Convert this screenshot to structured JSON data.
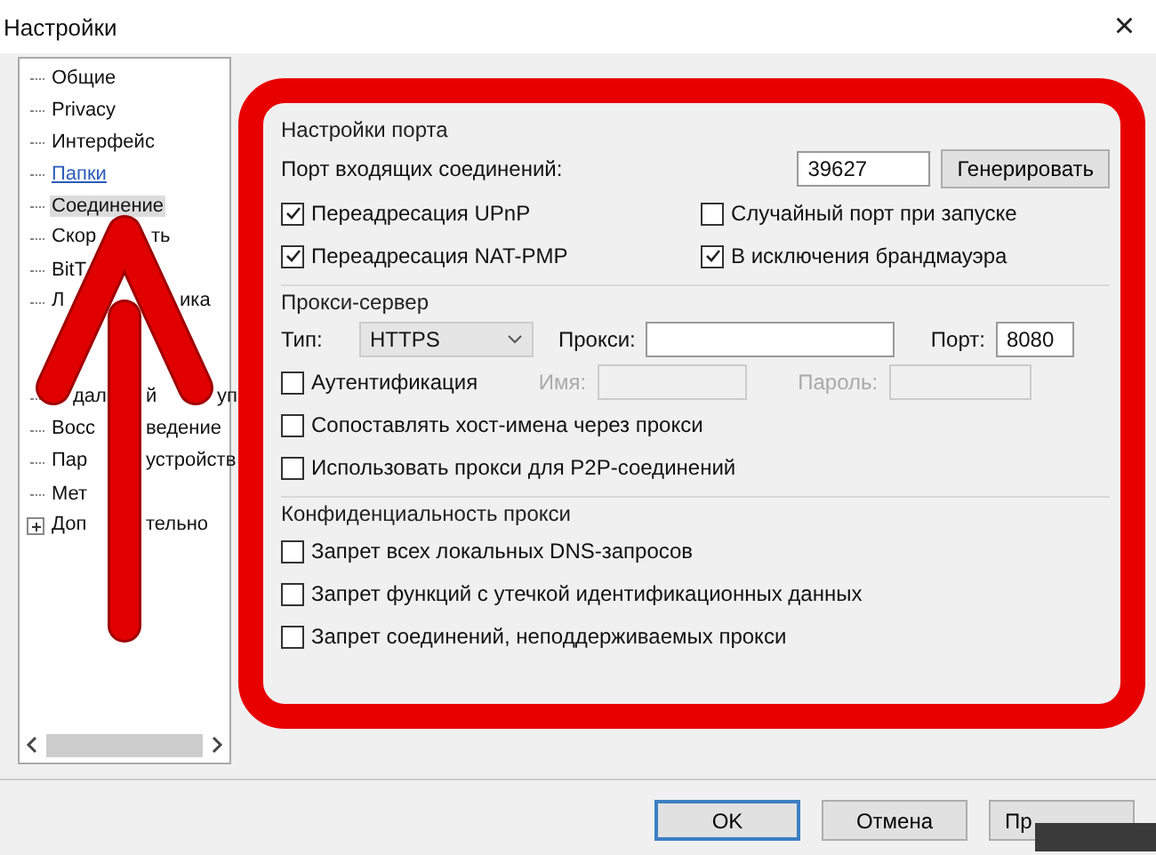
{
  "window": {
    "title": "Настройки",
    "close": "×"
  },
  "tree": {
    "items": [
      {
        "parts": [
          "Общие"
        ],
        "selected": false,
        "kind": "plain"
      },
      {
        "parts": [
          "Privacy"
        ],
        "selected": false,
        "kind": "plain"
      },
      {
        "parts": [
          "Интерфейс"
        ],
        "selected": false,
        "kind": "plain"
      },
      {
        "parts": [
          "Папки"
        ],
        "selected": false,
        "kind": "link"
      },
      {
        "parts": [
          "Соединение"
        ],
        "selected": true,
        "kind": "plain"
      },
      {
        "parts": [
          "Скор",
          "ть"
        ],
        "selected": false,
        "kind": "plain"
      },
      {
        "parts": [
          "BitT"
        ],
        "selected": false,
        "kind": "plain"
      },
      {
        "parts": [
          "Л",
          "ика"
        ],
        "selected": false,
        "kind": "plain"
      },
      {
        "selected": false,
        "kind": "hidden"
      },
      {
        "selected": false,
        "kind": "hidden"
      },
      {
        "parts": [
          "дал",
          "й",
          "уп"
        ],
        "selected": false,
        "kind": "plain"
      },
      {
        "parts": [
          "Восс",
          "ведение"
        ],
        "selected": false,
        "kind": "plain"
      },
      {
        "parts": [
          "Пар",
          "устройств"
        ],
        "selected": false,
        "kind": "plain"
      },
      {
        "parts": [
          "Мет"
        ],
        "selected": false,
        "kind": "plain"
      },
      {
        "parts": [
          "Доп",
          "тельно"
        ],
        "selected": false,
        "kind": "expander",
        "expanded": false
      }
    ]
  },
  "groups": [
    {
      "title": "Настройки порта",
      "rows": [
        {
          "kind": "port",
          "label": "Порт входящих соединений:",
          "value": "39627",
          "button": "Генерировать"
        },
        {
          "kind": "pair",
          "items": [
            {
              "label": "Переадресация UPnP",
              "checked": true
            },
            {
              "label": "Случайный порт при запуске",
              "checked": false
            }
          ]
        },
        {
          "kind": "pair",
          "items": [
            {
              "label": "Переадресация NAT-PMP",
              "checked": true
            },
            {
              "label": "В исключения брандмауэра",
              "checked": true
            }
          ]
        }
      ]
    },
    {
      "title": "Прокси-сервер",
      "rows": [
        {
          "kind": "proxy",
          "type_label": "Тип:",
          "type_value": "HTTPS",
          "proxy_label": "Прокси:",
          "port_label": "Порт:",
          "port_value": "8080"
        },
        {
          "kind": "auth",
          "label": "Аутентификация",
          "checked": false,
          "name_label": "Имя:",
          "password_label": "Пароль:",
          "disabled": true
        },
        {
          "kind": "check",
          "label": "Сопоставлять хост-имена через прокси",
          "checked": false
        },
        {
          "kind": "check",
          "label": "Использовать прокси для P2P-соединений",
          "checked": false
        }
      ]
    },
    {
      "title": "Конфиденциальность прокси",
      "rows": [
        {
          "kind": "check",
          "label": "Запрет всех локальных DNS-запросов",
          "checked": false
        },
        {
          "kind": "check",
          "label": "Запрет функций с утечкой идентификационных данных",
          "checked": false
        },
        {
          "kind": "check",
          "label": "Запрет соединений, неподдерживаемых прокси",
          "checked": false
        }
      ]
    }
  ],
  "buttons": [
    {
      "label": "OK",
      "default": true
    },
    {
      "label": "Отмена",
      "default": false
    },
    {
      "label": "Пр",
      "default": false
    }
  ]
}
